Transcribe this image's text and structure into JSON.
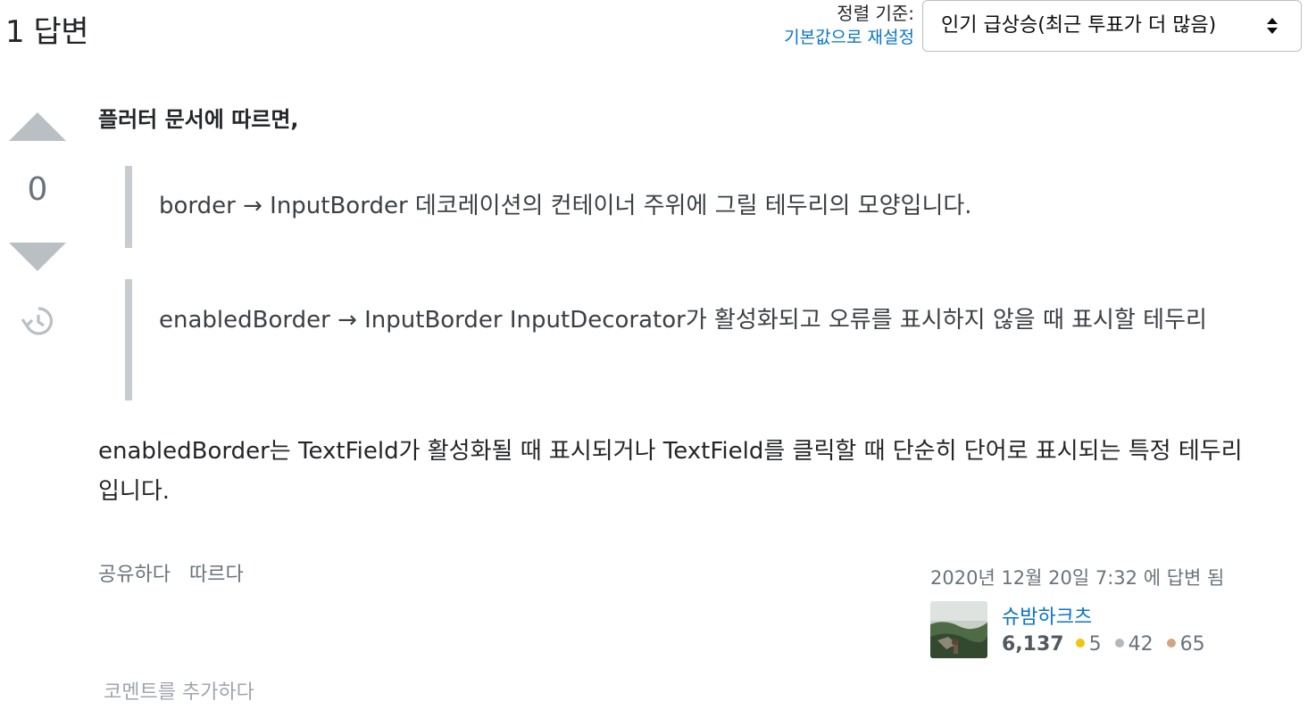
{
  "header": {
    "answers_count": "1 답변",
    "sort_label": "정렬 기준:",
    "sort_reset": "기본값으로 재설정",
    "sort_selected": "인기 급상승(최근 투표가 더 많음)"
  },
  "vote": {
    "count": "0"
  },
  "post": {
    "intro": "플러터 문서에 따르면,",
    "quote1": "border → InputBorder 데코레이션의 컨테이너 주위에 그릴 테두리의 모양입니다.",
    "quote2": "enabledBorder → InputBorder InputDecorator가 활성화되고 오류를 표시하지 않을 때 표시할 테두리",
    "text": "enabledBorder는 TextField가 활성화될 때 표시되거나 TextField를 클릭할 때 단순히 단어로 표시되는 특정 테두리입니다."
  },
  "menu": {
    "share": "공유하다",
    "follow": "따르다"
  },
  "user": {
    "answered": "2020년 12월 20일 7:32 에 답변 됨",
    "name": "슈밤하크츠",
    "reputation": "6,137",
    "gold": "5",
    "silver": "42",
    "bronze": "65",
    "gold_color": "#f1c40f",
    "silver_color": "#b4b8bc",
    "bronze_color": "#d1a684"
  },
  "comment": {
    "add_label": "코멘트를 추가하다"
  }
}
